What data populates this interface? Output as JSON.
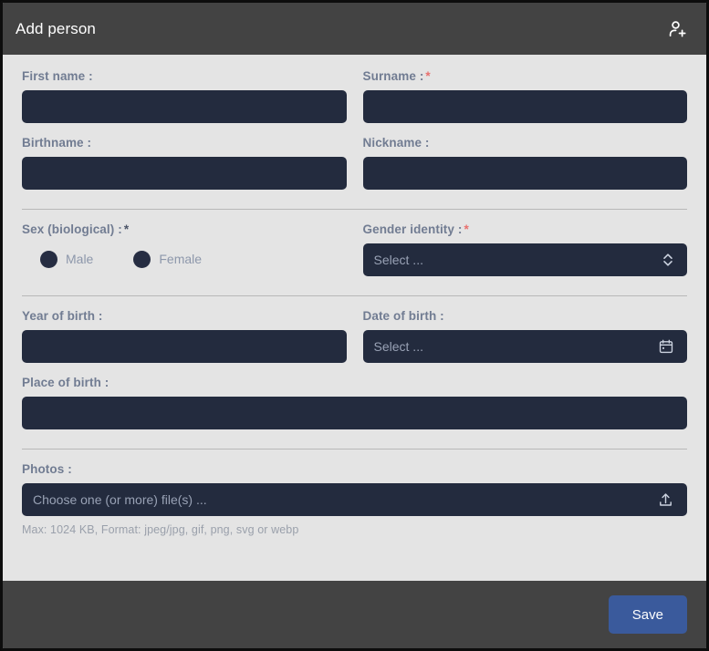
{
  "header": {
    "title": "Add person",
    "icon": "person-add-icon"
  },
  "form": {
    "first_name": {
      "label": "First name :",
      "value": "",
      "placeholder": ""
    },
    "surname": {
      "label": "Surname :",
      "required_mark": "*",
      "value": "",
      "placeholder": ""
    },
    "birthname": {
      "label": "Birthname :",
      "value": "",
      "placeholder": ""
    },
    "nickname": {
      "label": "Nickname :",
      "value": "",
      "placeholder": ""
    },
    "sex": {
      "label": "Sex (biological) :",
      "required_mark": "*",
      "options": [
        {
          "label": "Male",
          "value": "male"
        },
        {
          "label": "Female",
          "value": "female"
        }
      ]
    },
    "gender_identity": {
      "label": "Gender identity :",
      "required_mark": "*",
      "placeholder": "Select ...",
      "icon": "chevron-up-down-icon"
    },
    "year_of_birth": {
      "label": "Year of birth :",
      "value": "",
      "placeholder": ""
    },
    "date_of_birth": {
      "label": "Date of birth :",
      "placeholder": "Select ...",
      "icon": "calendar-icon"
    },
    "place_of_birth": {
      "label": "Place of birth :",
      "value": "",
      "placeholder": ""
    },
    "photos": {
      "label": "Photos :",
      "placeholder": "Choose one (or more) file(s) ...",
      "icon": "upload-icon",
      "hint": "Max: 1024 KB, Format: jpeg/jpg, gif, png, svg or webp"
    }
  },
  "footer": {
    "save_label": "Save"
  },
  "colors": {
    "header_bg": "#434343",
    "body_bg": "#e4e4e4",
    "input_bg": "#232b3e",
    "label": "#717c92",
    "required": "#e8706e",
    "accent": "#3a5a9c",
    "placeholder": "#99a2b5"
  }
}
